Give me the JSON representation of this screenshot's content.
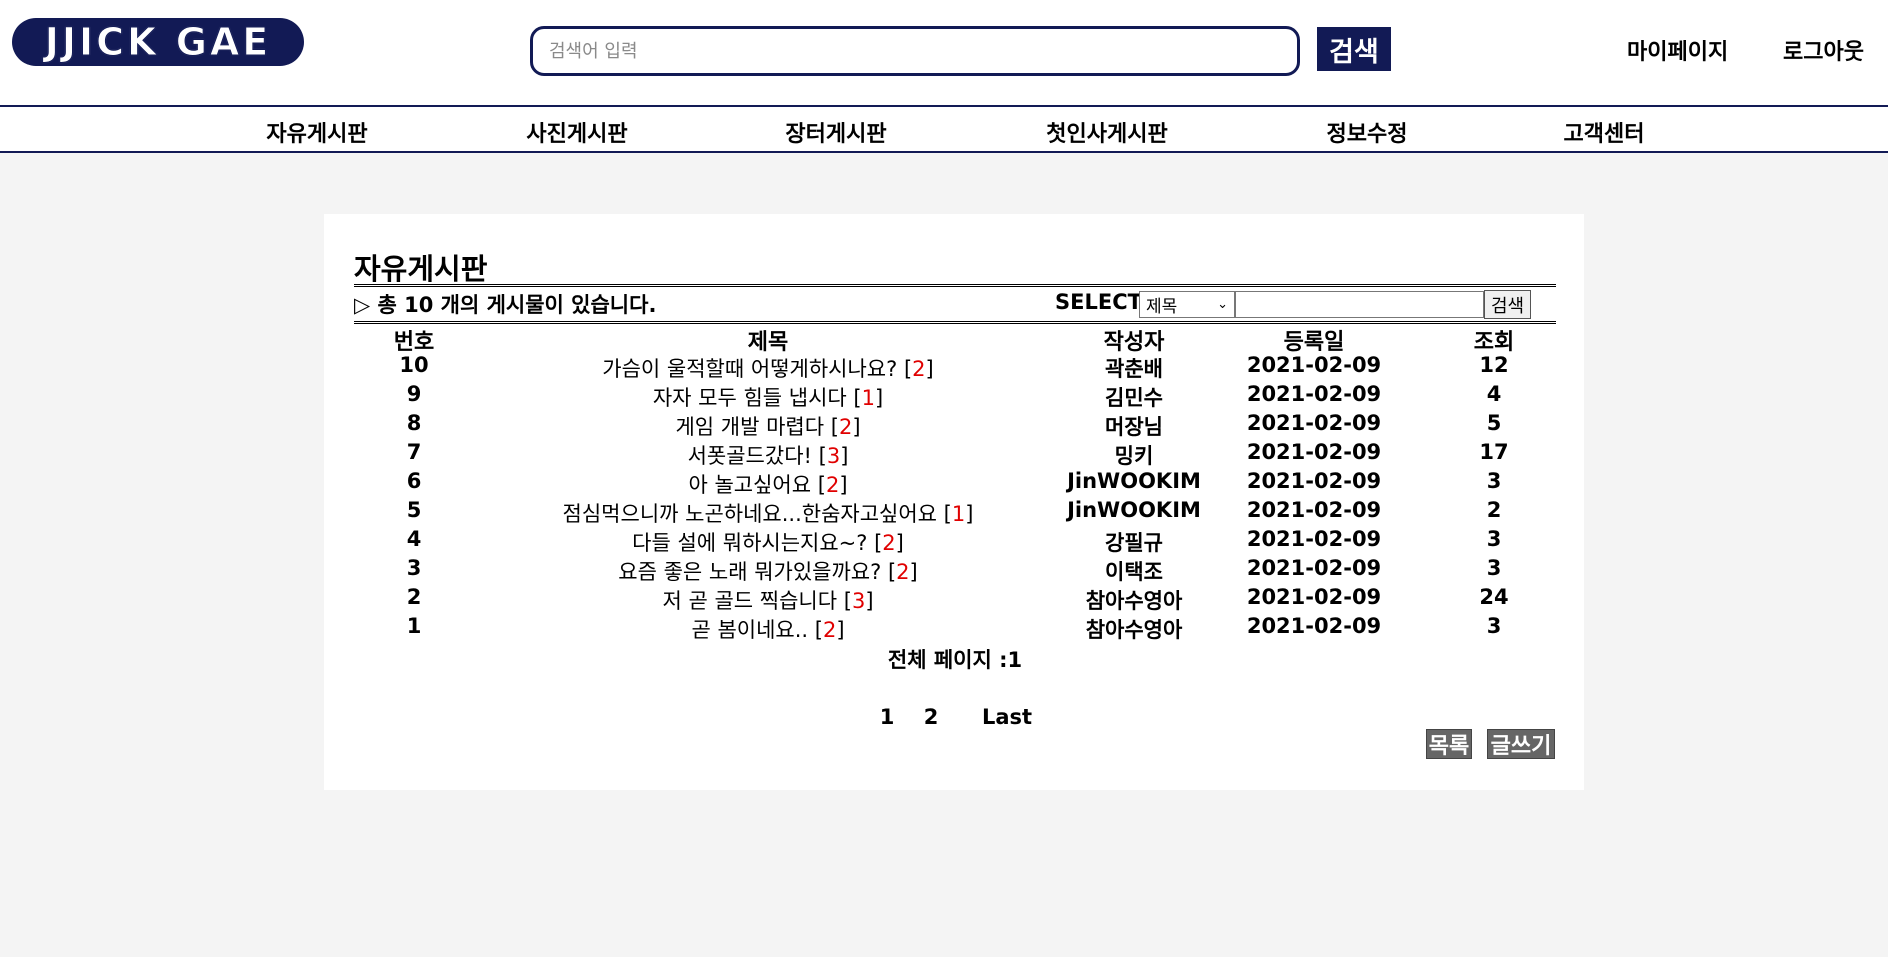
{
  "header": {
    "logo": "JJICK GAE",
    "search_placeholder": "검색어 입력",
    "search_button": "검색",
    "mypage": "마이페이지",
    "logout": "로그아웃"
  },
  "nav": [
    "자유게시판",
    "사진게시판",
    "장터게시판",
    "첫인사게시판",
    "정보수정",
    "고객센터"
  ],
  "board": {
    "title": "자유게시판",
    "count_text": "▷ 총 10 개의 게시물이 있습니다.",
    "select_label": "SELECT",
    "select_value": "제목",
    "search_button": "검색",
    "columns": [
      "번호",
      "제목",
      "작성자",
      "등록일",
      "조회"
    ],
    "rows": [
      {
        "no": "10",
        "title": "가슴이 울적할때 어떻게하시나요?",
        "comments": "2",
        "author": "곽춘배",
        "date": "2021-02-09",
        "views": "12"
      },
      {
        "no": "9",
        "title": "자자 모두 힘들 냅시다",
        "comments": "1",
        "author": "김민수",
        "date": "2021-02-09",
        "views": "4"
      },
      {
        "no": "8",
        "title": "게임 개발 마렵다",
        "comments": "2",
        "author": "머장님",
        "date": "2021-02-09",
        "views": "5"
      },
      {
        "no": "7",
        "title": "서폿골드갔다!",
        "comments": "3",
        "author": "밍키",
        "date": "2021-02-09",
        "views": "17"
      },
      {
        "no": "6",
        "title": "아 놀고싶어요",
        "comments": "2",
        "author": "JinWOOKIM",
        "date": "2021-02-09",
        "views": "3"
      },
      {
        "no": "5",
        "title": "점심먹으니까 노곤하네요...한숨자고싶어요",
        "comments": "1",
        "author": "JinWOOKIM",
        "date": "2021-02-09",
        "views": "2"
      },
      {
        "no": "4",
        "title": "다들 설에 뭐하시는지요~?",
        "comments": "2",
        "author": "강필규",
        "date": "2021-02-09",
        "views": "3"
      },
      {
        "no": "3",
        "title": "요즘 좋은 노래 뭐가있을까요?",
        "comments": "2",
        "author": "이택조",
        "date": "2021-02-09",
        "views": "3"
      },
      {
        "no": "2",
        "title": "저 곧 골드 찍습니다",
        "comments": "3",
        "author": "참아수영아",
        "date": "2021-02-09",
        "views": "24"
      },
      {
        "no": "1",
        "title": "곧 봄이네요..",
        "comments": "2",
        "author": "참아수영아",
        "date": "2021-02-09",
        "views": "3"
      }
    ],
    "total_pages": "전체 페이지 :1",
    "pages": [
      "1",
      "2",
      "Last"
    ],
    "list_button": "목록",
    "write_button": "글쓰기"
  },
  "colors": {
    "brand": "#121a55",
    "comment_count": "#e00000",
    "action_button": "#666666"
  }
}
